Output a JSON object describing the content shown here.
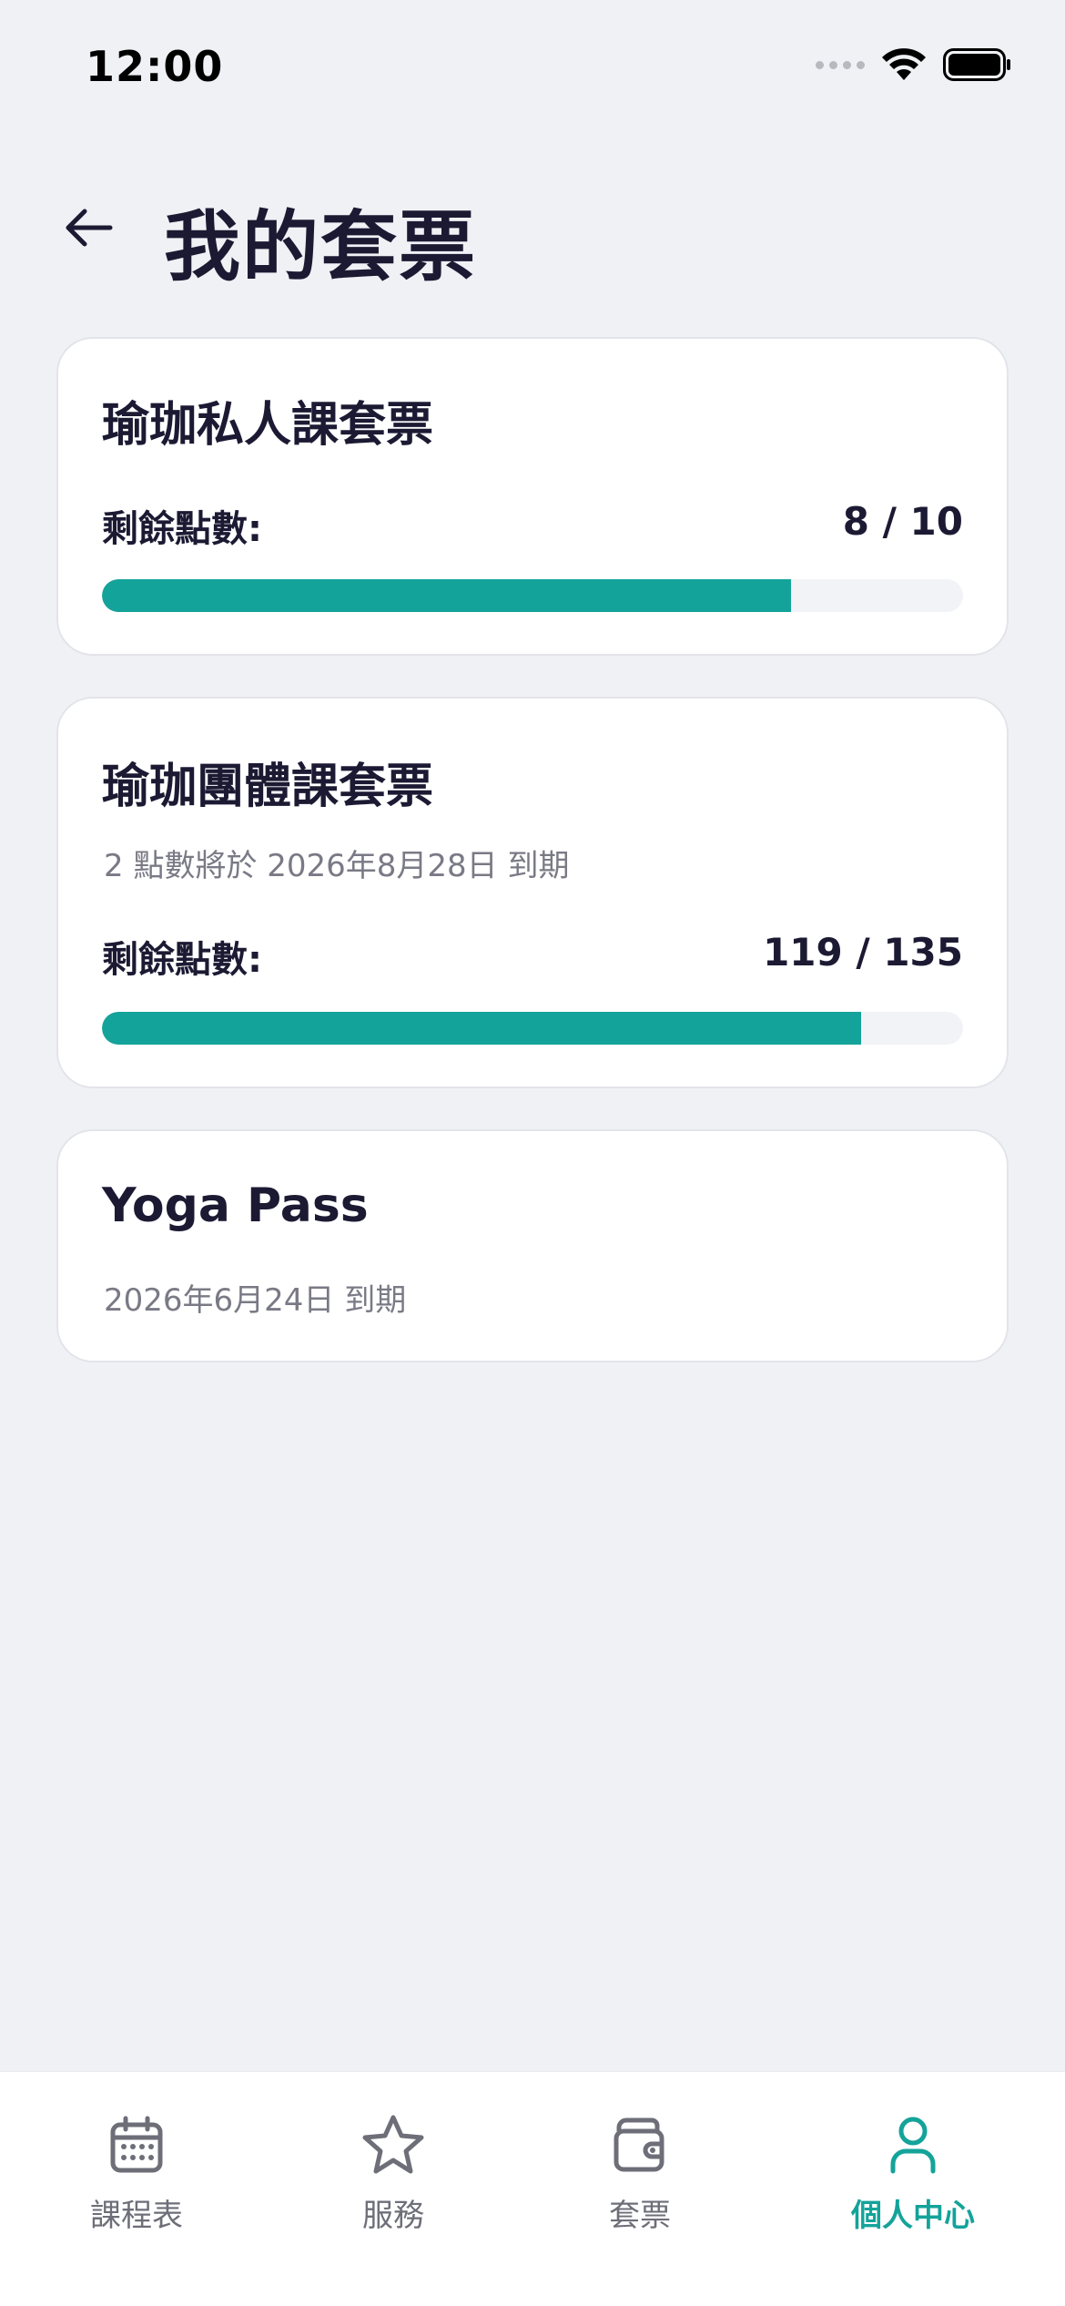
{
  "status": {
    "time": "12:00"
  },
  "header": {
    "title": "我的套票"
  },
  "cards": [
    {
      "title": "瑜珈私人課套票",
      "points_label": "剩餘點數:",
      "points_value": "8 / 10",
      "progress": 0.8
    },
    {
      "title": "瑜珈團體課套票",
      "expiry_note": "2 點數將於 2026年8月28日 到期",
      "points_label": "剩餘點數:",
      "points_value": "119 / 135",
      "progress": 0.8815
    },
    {
      "title": "Yoga Pass",
      "expiry_note": "2026年6月24日 到期"
    }
  ],
  "nav": {
    "items": [
      {
        "label": "課程表",
        "icon": "calendar-icon",
        "active": false
      },
      {
        "label": "服務",
        "icon": "star-icon",
        "active": false
      },
      {
        "label": "套票",
        "icon": "wallet-icon",
        "active": false
      },
      {
        "label": "個人中心",
        "icon": "user-icon",
        "active": true
      }
    ]
  },
  "colors": {
    "accent": "#14a39a",
    "text": "#1c1a33",
    "muted": "#7a7a86",
    "background": "#f0f1f5"
  }
}
